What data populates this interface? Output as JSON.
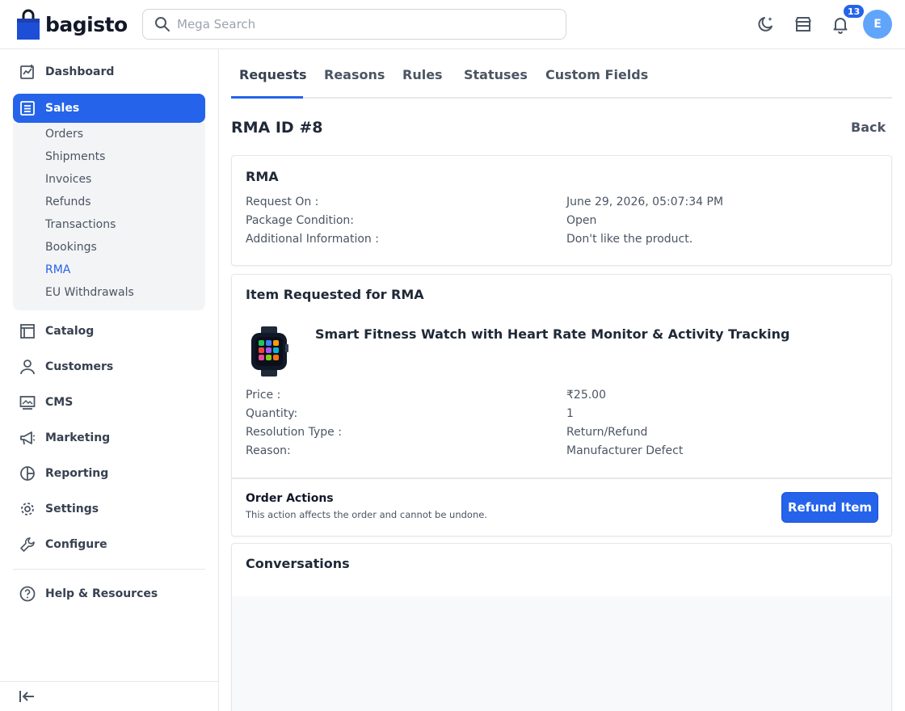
{
  "app": {
    "logo_text": "bagisto"
  },
  "header": {
    "search_placeholder": "Mega Search",
    "notification_count": "13",
    "avatar_initial": "E"
  },
  "sidebar": {
    "items": [
      {
        "label": "Dashboard",
        "icon": "dashboard-icon"
      },
      {
        "label": "Sales",
        "icon": "sales-icon"
      },
      {
        "label": "Catalog",
        "icon": "catalog-icon"
      },
      {
        "label": "Customers",
        "icon": "customers-icon"
      },
      {
        "label": "CMS",
        "icon": "cms-icon"
      },
      {
        "label": "Marketing",
        "icon": "marketing-icon"
      },
      {
        "label": "Reporting",
        "icon": "reporting-icon"
      },
      {
        "label": "Settings",
        "icon": "settings-icon"
      },
      {
        "label": "Configure",
        "icon": "configure-icon"
      },
      {
        "label": "Help & Resources",
        "icon": "help-icon"
      }
    ],
    "sales_sub": [
      "Orders",
      "Shipments",
      "Invoices",
      "Refunds",
      "Transactions",
      "Bookings",
      "RMA",
      "EU Withdrawals"
    ],
    "active_item": "Sales",
    "active_sub": "RMA"
  },
  "tabs": [
    "Requests",
    "Reasons",
    "Rules",
    "Statuses",
    "Custom Fields"
  ],
  "page": {
    "title": "RMA ID #8",
    "back_label": "Back"
  },
  "rma_card": {
    "title": "RMA",
    "rows": [
      {
        "label": "Request On :",
        "value": "June 29, 2026, 05:07:34 PM"
      },
      {
        "label": "Package Condition:",
        "value": "Open"
      },
      {
        "label": "Additional Information :",
        "value": "Don't like the product."
      }
    ]
  },
  "item_card": {
    "title": "Item Requested for RMA",
    "product_name": "Smart Fitness Watch with Heart Rate Monitor & Activity Tracking",
    "rows": [
      {
        "label": "Price :",
        "value": "₹25.00"
      },
      {
        "label": "Quantity:",
        "value": "1"
      },
      {
        "label": "Resolution Type :",
        "value": "Return/Refund"
      },
      {
        "label": "Reason:",
        "value": "Manufacturer Defect"
      }
    ],
    "actions_title": "Order Actions",
    "actions_note": "This action affects the order and cannot be undone.",
    "refund_label": "Refund Item"
  },
  "conversations": {
    "title": "Conversations"
  },
  "colors": {
    "accent": "#2563eb",
    "avatar": "#60a5fa"
  }
}
